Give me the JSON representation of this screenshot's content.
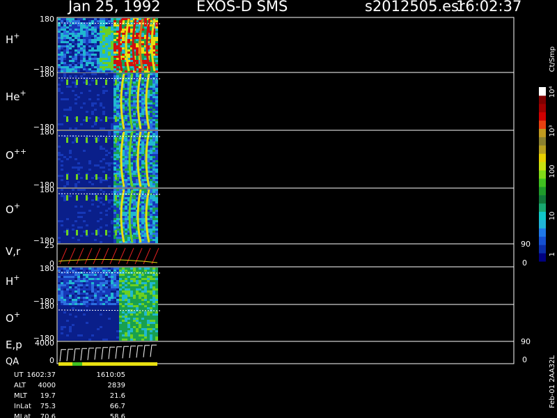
{
  "header": {
    "date": "Jan 25, 1992",
    "instrument": "EXOS-D SMS",
    "file": "s2012505.esr",
    "time": "16:02:37"
  },
  "colorbar": {
    "title": "Ct/Smp",
    "tick_labels": [
      "1",
      "10",
      "100",
      "10³",
      "10⁴"
    ],
    "colors": [
      "#000080",
      "#0a2ea8",
      "#1550d0",
      "#1f78e8",
      "#20b4d8",
      "#10c8c8",
      "#18a870",
      "#10783a",
      "#1f9a2a",
      "#40c020",
      "#80d818",
      "#c8e010",
      "#e8d000",
      "#b8a020",
      "#8a8030",
      "#c09a20",
      "#e84010",
      "#d00000",
      "#a00000",
      "#800000",
      "#ffffff"
    ]
  },
  "panels": [
    {
      "label_base": "H",
      "label_sup": "+",
      "ymax": "180",
      "ymin": "−180"
    },
    {
      "label_base": "He",
      "label_sup": "+",
      "ymax": "180",
      "ymin": "−180"
    },
    {
      "label_base": "O",
      "label_sup": "++",
      "ymax": "180",
      "ymin": "−180"
    },
    {
      "label_base": "O",
      "label_sup": "+",
      "ymax": "180",
      "ymin": "−180"
    },
    {
      "label_base": "V,r",
      "label_sup": "",
      "ymax": "25",
      "ymin": "0",
      "right_max": "90",
      "right_min": "0"
    },
    {
      "label_base": "H",
      "label_sup": "+",
      "ymax": "180",
      "ymin": "−180"
    },
    {
      "label_base": "O",
      "label_sup": "+",
      "ymax": "180",
      "ymin": "−180"
    },
    {
      "label_base": "E,p",
      "label_sup": "",
      "ymax": "4000",
      "ymin": "0",
      "right_max": "90",
      "right_min": "0"
    }
  ],
  "qa_label": "QA",
  "footer": {
    "rows": [
      {
        "name": "UT",
        "v1": "1602:37",
        "v2": "1610:05"
      },
      {
        "name": "ALT",
        "v1": "4000",
        "v2": "2839"
      },
      {
        "name": "MLT",
        "v1": "19.7",
        "v2": "21.6"
      },
      {
        "name": "InLat",
        "v1": "75.3",
        "v2": "66.7"
      },
      {
        "name": "MLat",
        "v1": "70.6",
        "v2": "58.6"
      }
    ]
  },
  "side_stamp": "Feb-01 2AA32L",
  "chart_data": {
    "type": "heatmap",
    "x": [
      "1602:37",
      "1610:05"
    ],
    "panels": [
      "H+",
      "He+",
      "O++",
      "O+",
      "V,r",
      "H+",
      "O+",
      "E,p"
    ],
    "ylim_pitch": [
      -180,
      180
    ],
    "ylim_vr": [
      0,
      25
    ],
    "ylim_ep": [
      0,
      4000
    ],
    "colorscale": {
      "label": "Ct/Smp",
      "type": "log",
      "range": [
        1,
        10000
      ]
    }
  }
}
